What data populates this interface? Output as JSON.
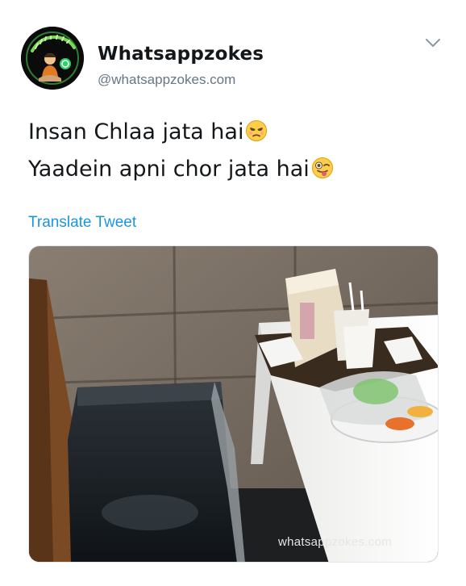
{
  "tweet": {
    "display_name": "Whatsappzokes",
    "handle": "@whatsappzokes.com",
    "avatar_logo_text": "Whatsapp zokes",
    "menu_icon": "chevron-down-icon",
    "text_lines": [
      {
        "text": "Insan Chlaa jata hai",
        "emoji": "unamused-face"
      },
      {
        "text": "Yaadein apni chor jata hai",
        "emoji": "winking-face-with-tongue"
      }
    ],
    "translate_label": "Translate Tweet",
    "media": {
      "description_icon": "photo",
      "watermark": "whatsappzokes.com"
    },
    "colors": {
      "link": "#1b95e0",
      "secondary_text": "#657786",
      "primary_text": "#14171a"
    }
  }
}
